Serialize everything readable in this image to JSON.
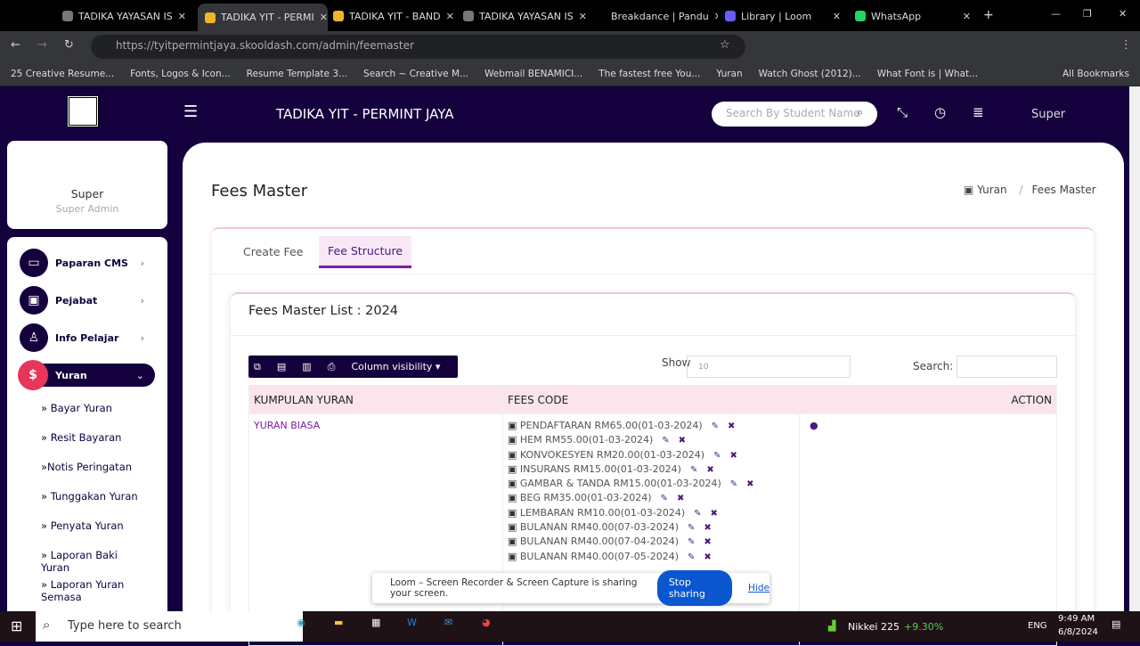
{
  "browser": {
    "tabs": [
      {
        "label": "TADIKA YAYASAN IS",
        "color": "#777"
      },
      {
        "label": "TADIKA YIT - PERMI",
        "color": "#f0b429",
        "active": true
      },
      {
        "label": "TADIKA YIT - BAND",
        "color": "#f0b429"
      },
      {
        "label": "TADIKA YAYASAN IS",
        "color": "#777"
      },
      {
        "label": "Breakdance | Pandu",
        "color": "#000"
      },
      {
        "label": "Library | Loom",
        "color": "#6a5cff"
      },
      {
        "label": "WhatsApp",
        "color": "#25d366"
      }
    ],
    "url": "https://tyitpermintjaya.skooldash.com/admin/feemaster",
    "bookmarks": [
      "25 Creative Resume...",
      "Fonts, Logos & Icon...",
      "Resume Template 3...",
      "Search ~ Creative M...",
      "Webmail BENAMICI...",
      "The fastest free You...",
      "Yuran",
      "Watch Ghost (2012)...",
      "What Font is | What..."
    ],
    "all_bookmarks": "All Bookmarks"
  },
  "header": {
    "title": "TADIKA YIT - PERMINT JAYA",
    "search_placeholder": "Search By Student Name",
    "user": "Super"
  },
  "profile": {
    "name": "Super",
    "role": "Super Admin"
  },
  "sidebar": {
    "items": [
      {
        "label": "Paparan CMS",
        "icon": "monitor-icon"
      },
      {
        "label": "Pejabat",
        "icon": "briefcase-icon"
      },
      {
        "label": "Info Pelajar",
        "icon": "graduate-icon"
      },
      {
        "label": "Yuran",
        "icon": "money-hand-icon",
        "active": true
      }
    ],
    "sub": [
      "» Bayar Yuran",
      "» Resit Bayaran",
      "»Notis Peringatan",
      "» Tunggakan Yuran",
      "» Penyata Yuran",
      "» Laporan Baki Yuran",
      "» Laporan Yuran Semasa"
    ]
  },
  "page": {
    "title": "Fees Master",
    "breadcrumb": [
      "Yuran",
      "Fees Master"
    ],
    "tabs": [
      "Create Fee",
      "Fee Structure"
    ],
    "active_tab": "Fee Structure",
    "list_title": "Fees Master List : 2024",
    "column_visibility": "Column visibility ▾",
    "show_label": "Show",
    "show_value": "10",
    "search_label": "Search:",
    "columns": [
      "KUMPULAN YURAN",
      "FEES CODE",
      "ACTION"
    ],
    "rows": [
      {
        "group": "YURAN BIASA",
        "fees": [
          "PENDAFTARAN RM65.00(01-03-2024)",
          "HEM RM55.00(01-03-2024)",
          "KONVOKESYEN RM20.00(01-03-2024)",
          "INSURANS RM15.00(01-03-2024)",
          "GAMBAR & TANDA RM15.00(01-03-2024)",
          "BEG RM35.00(01-03-2024)",
          "LEMBARAN RM10.00(01-03-2024)",
          "BULANAN RM40.00(07-03-2024)",
          "BULANAN RM40.00(07-04-2024)",
          "BULANAN RM40.00(07-05-2024)"
        ]
      }
    ]
  },
  "loom": {
    "message": "Loom – Screen Recorder & Screen Capture is sharing your screen.",
    "stop": "Stop sharing",
    "hide": "Hide"
  },
  "taskbar": {
    "search": "Type here to search",
    "ticker": "Nikkei 225",
    "change": "+9.30%",
    "lang": "ENG",
    "time": "9:49 AM",
    "date": "6/8/2024"
  },
  "colors": {
    "navy": "#13003d",
    "accent": "#e8365a",
    "tab_underline": "#7b1fa2"
  }
}
